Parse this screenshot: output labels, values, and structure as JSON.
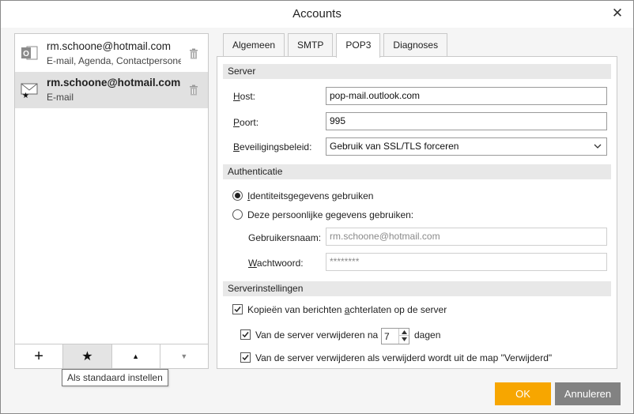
{
  "window": {
    "title": "Accounts",
    "close_glyph": "✕"
  },
  "accounts": [
    {
      "email": "rm.schoone@hotmail.com",
      "description": "E-mail, Agenda, Contactpersonen",
      "icon": "outlook-icon",
      "selected": false
    },
    {
      "email": "rm.schoone@hotmail.com",
      "description": "E-mail",
      "icon": "mail-default-icon",
      "selected": true
    }
  ],
  "toolbar": {
    "add": "+",
    "default": "★",
    "up": "▲",
    "down": "▼",
    "tooltip": "Als standaard instellen"
  },
  "tabs": [
    "Algemeen",
    "SMTP",
    "POP3",
    "Diagnoses"
  ],
  "active_tab": "POP3",
  "server": {
    "heading": "Server",
    "host_label": "Host:",
    "host_value": "pop-mail.outlook.com",
    "port_label": "Poort:",
    "port_value": "995",
    "security_label": "Beveiligingsbeleid:",
    "security_value": "Gebruik van SSL/TLS forceren"
  },
  "auth": {
    "heading": "Authenticatie",
    "option_identity": "Identiteitsgegevens gebruiken",
    "option_personal": "Deze persoonlijke gegevens gebruiken:",
    "username_label": "Gebruikersnaam:",
    "username_value": "rm.schoone@hotmail.com",
    "password_label": "Wachtwoord:",
    "password_value": "********"
  },
  "server_settings": {
    "heading": "Serverinstellingen",
    "keep_copies": "Kopieën van berichten achterlaten op de server",
    "delete_after_prefix": "Van de server verwijderen na",
    "delete_after_days": "7",
    "delete_after_suffix": "dagen",
    "delete_when_removed": "Van de server verwijderen als verwijderd wordt uit de map \"Verwijderd\""
  },
  "buttons": {
    "ok": "OK",
    "cancel": "Annuleren"
  },
  "colors": {
    "ok": "#f7a600",
    "cancel": "#828282",
    "selected_row": "#e1e1e1"
  }
}
